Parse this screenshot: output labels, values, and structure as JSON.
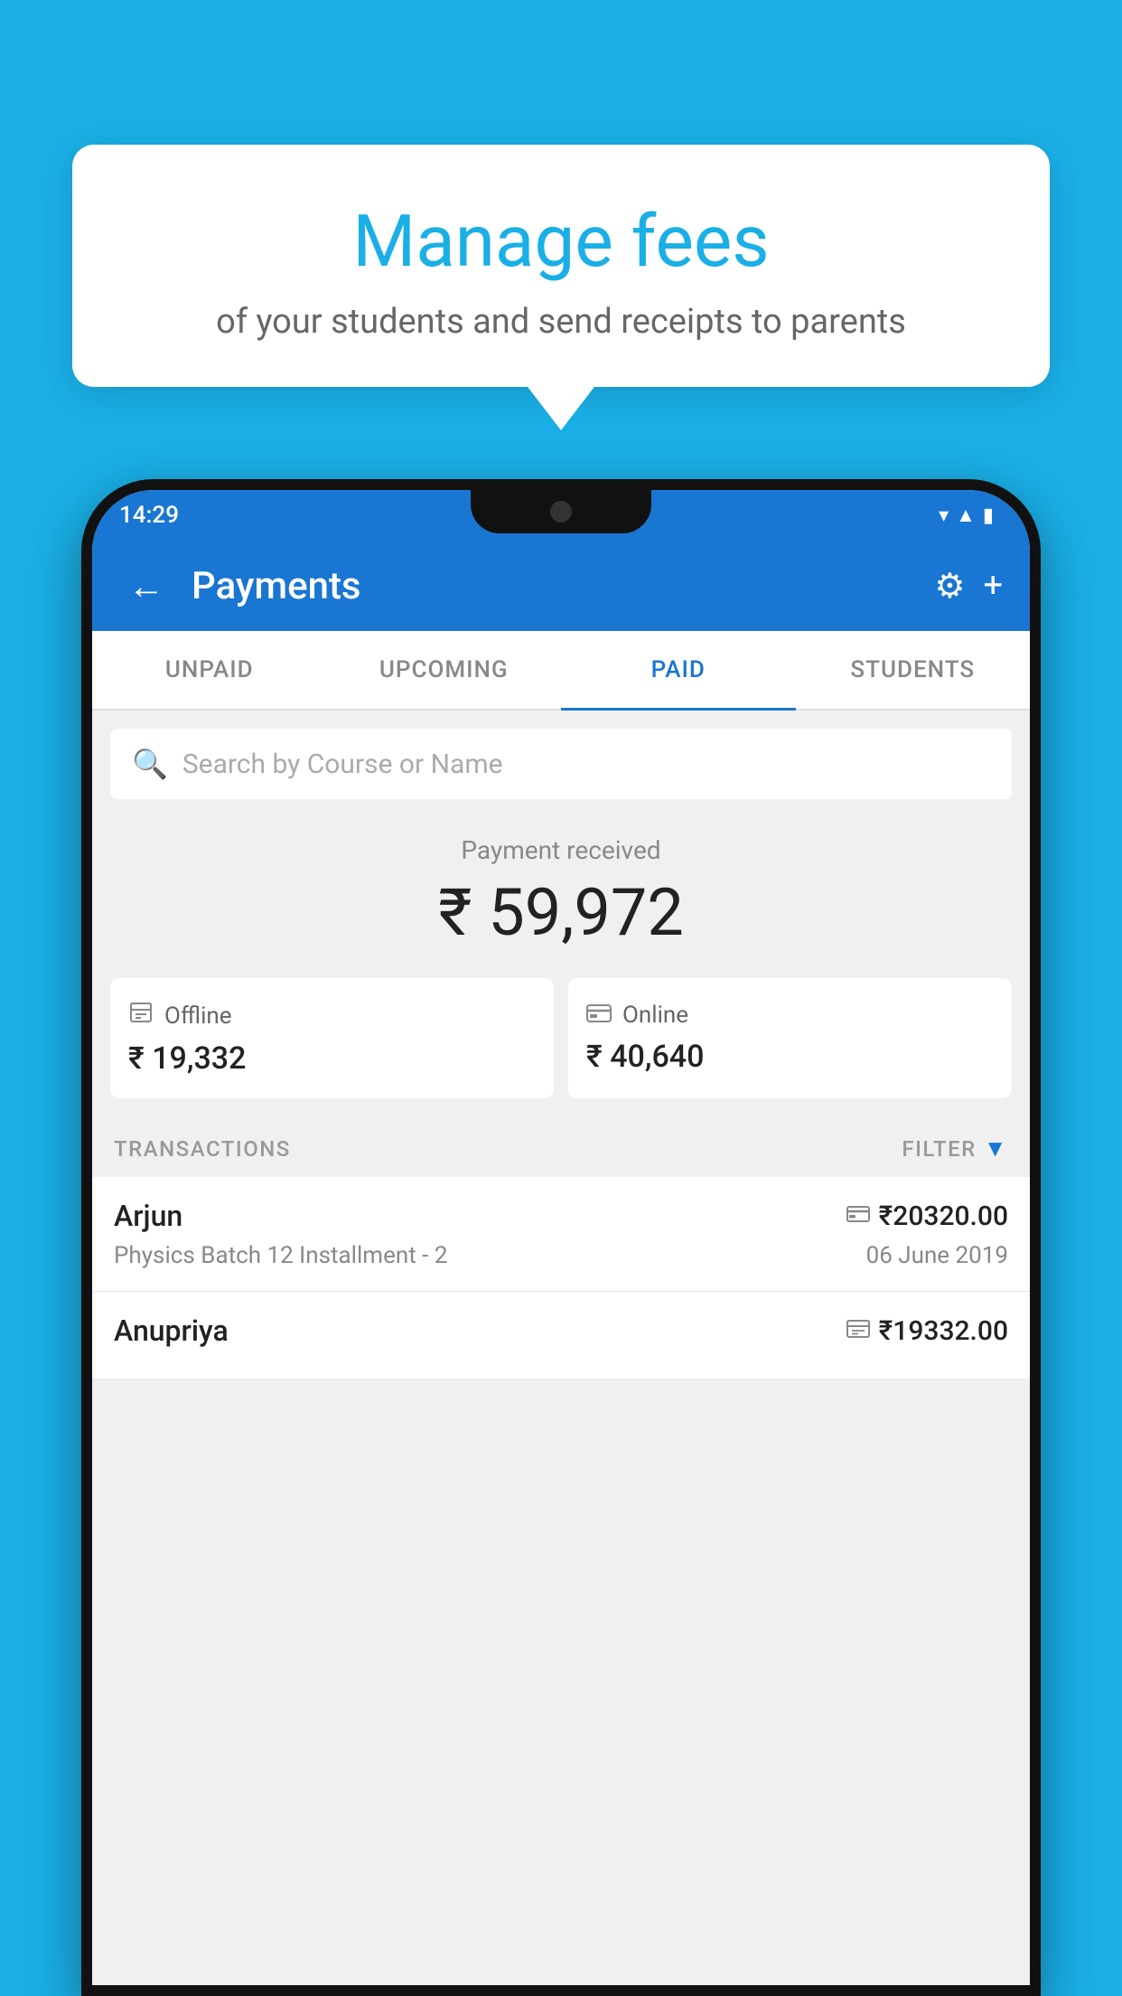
{
  "background_color": "#1AAFE6",
  "speech_bubble": {
    "title": "Manage fees",
    "subtitle": "of your students and send receipts to parents"
  },
  "phone": {
    "status_bar": {
      "time": "14:29",
      "icons": [
        "wifi",
        "signal",
        "battery"
      ]
    },
    "top_bar": {
      "title": "Payments",
      "back_label": "←",
      "settings_label": "⚙",
      "add_label": "+"
    },
    "tabs": [
      {
        "label": "UNPAID",
        "active": false
      },
      {
        "label": "UPCOMING",
        "active": false
      },
      {
        "label": "PAID",
        "active": true
      },
      {
        "label": "STUDENTS",
        "active": false
      }
    ],
    "search": {
      "placeholder": "Search by Course or Name"
    },
    "payment_received": {
      "label": "Payment received",
      "amount": "₹ 59,972"
    },
    "payment_methods": [
      {
        "icon": "💳",
        "label": "Offline",
        "amount": "₹ 19,332"
      },
      {
        "icon": "💳",
        "label": "Online",
        "amount": "₹ 40,640"
      }
    ],
    "transactions_section": {
      "label": "TRANSACTIONS",
      "filter_label": "FILTER"
    },
    "transactions": [
      {
        "name": "Arjun",
        "course": "Physics Batch 12 Installment - 2",
        "amount": "₹20320.00",
        "date": "06 June 2019",
        "payment_type": "online"
      },
      {
        "name": "Anupriya",
        "course": "",
        "amount": "₹19332.00",
        "date": "",
        "payment_type": "offline"
      }
    ]
  }
}
